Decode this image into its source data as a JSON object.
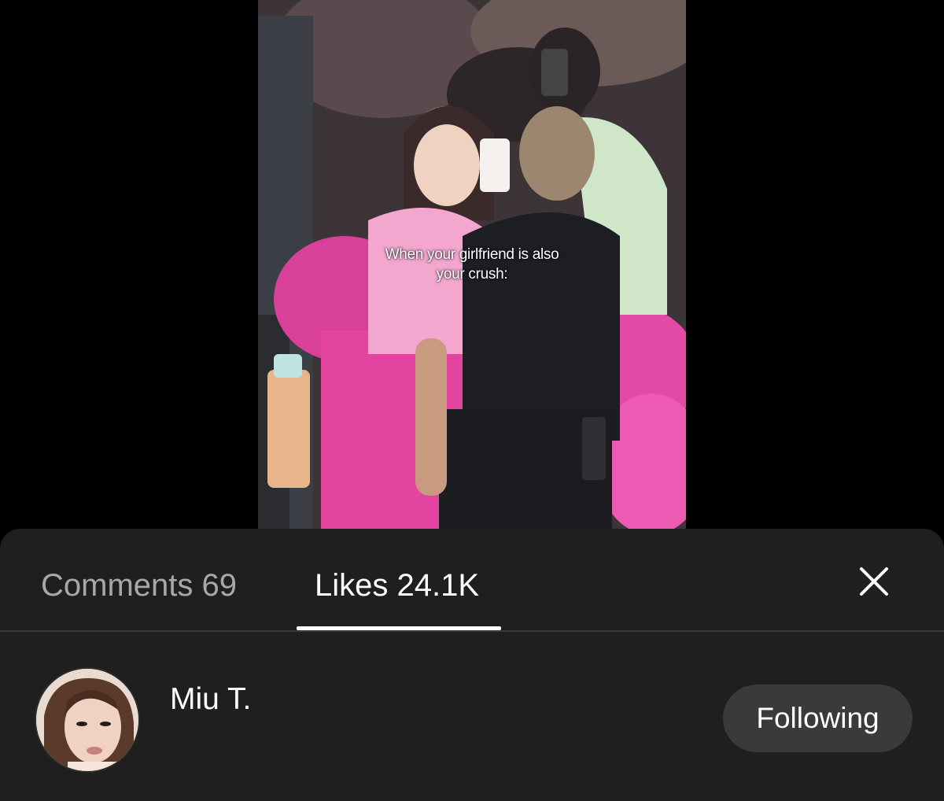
{
  "video": {
    "caption_line1": "When your girlfriend is also",
    "caption_line2": "your crush:"
  },
  "sheet": {
    "tabs": [
      {
        "label": "Comments 69",
        "active": false
      },
      {
        "label": "Likes 24.1K",
        "active": true
      }
    ],
    "close_icon": "close-icon"
  },
  "likes_list": [
    {
      "name": "Miu T.",
      "button_label": "Following"
    }
  ],
  "colors": {
    "sheet_background": "#1f1f1f",
    "inactive_tab_text": "#a8a8a8",
    "active_tab_text": "#ffffff",
    "button_background": "#3a3a3a",
    "divider": "#3a3a3a"
  }
}
